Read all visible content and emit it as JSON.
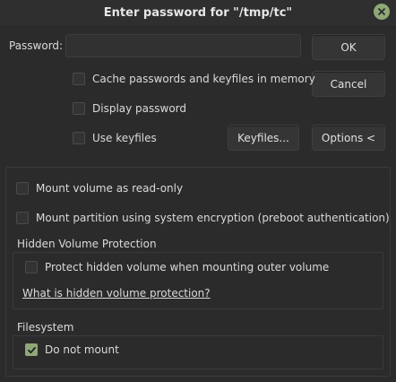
{
  "window": {
    "title": "Enter password for \"/tmp/tc\""
  },
  "password": {
    "label": "Password:",
    "value": "",
    "placeholder": ""
  },
  "buttons": {
    "ok": "OK",
    "cancel": "Cancel",
    "keyfiles": "Keyfiles...",
    "options": "Options <"
  },
  "checkboxes": {
    "cache": {
      "label": "Cache passwords and keyfiles in memory",
      "checked": false
    },
    "display_password": {
      "label": "Display password",
      "checked": false
    },
    "use_keyfiles": {
      "label": "Use keyfiles",
      "checked": false
    },
    "read_only": {
      "label": "Mount volume as read-only",
      "checked": false
    },
    "system_encryption": {
      "label": "Mount partition using system encryption (preboot authentication)",
      "checked": false
    },
    "protect_hidden": {
      "label": "Protect hidden volume when mounting outer volume",
      "checked": false
    },
    "do_not_mount": {
      "label": "Do not mount",
      "checked": true
    }
  },
  "hidden_volume": {
    "title": "Hidden Volume Protection",
    "link": "What is hidden volume protection?"
  },
  "filesystem": {
    "title": "Filesystem"
  },
  "colors": {
    "accent": "#8fa877",
    "background": "#2b2b2b"
  }
}
